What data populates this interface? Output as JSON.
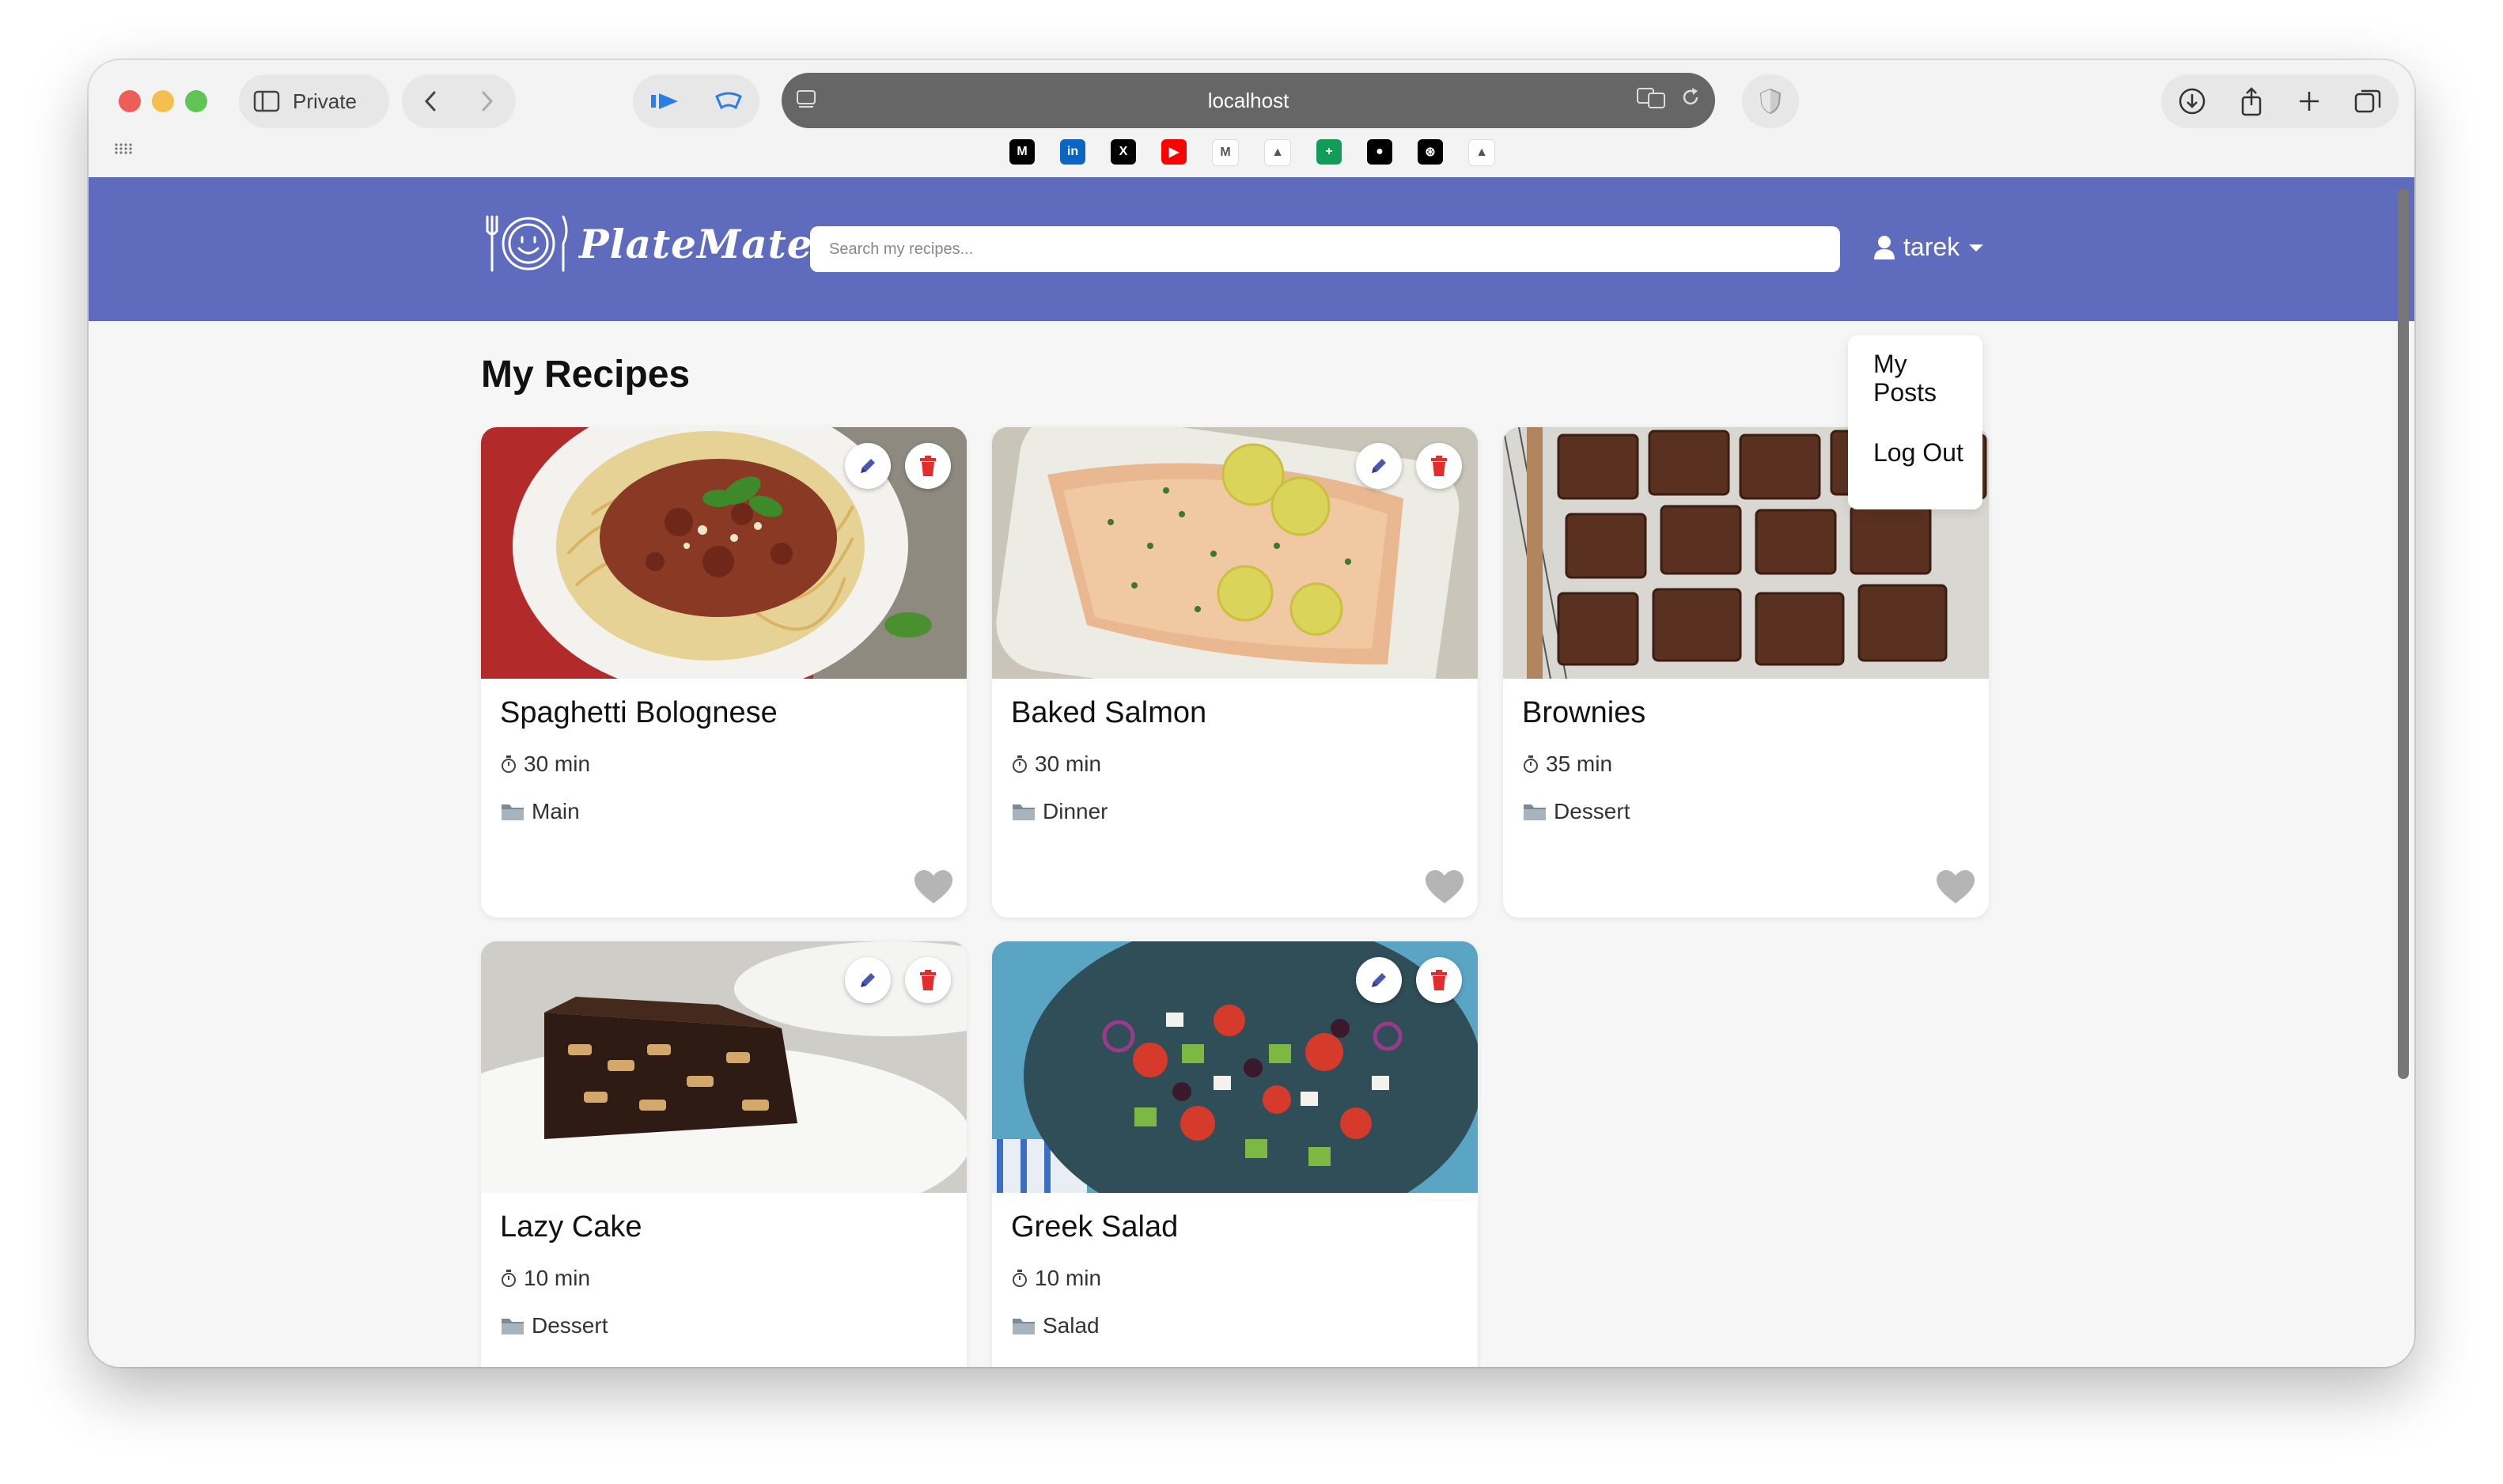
{
  "browser": {
    "private_label": "Private",
    "address": "localhost",
    "bookmarks": [
      {
        "icon": "medium-icon",
        "color": "#000000",
        "glyph": "M"
      },
      {
        "icon": "linkedin-icon",
        "color": "#0a66c2",
        "glyph": "in"
      },
      {
        "icon": "x-icon",
        "color": "#000000",
        "glyph": "X"
      },
      {
        "icon": "youtube-icon",
        "color": "#ff0000",
        "glyph": "▶"
      },
      {
        "icon": "gmail-icon",
        "color": "#ffffff",
        "glyph": "M"
      },
      {
        "icon": "google-drive-icon",
        "color": "#ffffff",
        "glyph": "▲"
      },
      {
        "icon": "google-sheets-icon",
        "color": "#0f9d58",
        "glyph": "+"
      },
      {
        "icon": "github-icon",
        "color": "#000000",
        "glyph": "●"
      },
      {
        "icon": "openai-icon",
        "color": "#000000",
        "glyph": "⊛"
      },
      {
        "icon": "vercel-icon",
        "color": "#ffffff",
        "glyph": "▲"
      }
    ]
  },
  "app": {
    "brand": "PlateMate",
    "brand_color": "#5f6bbd",
    "search_placeholder": "Search my recipes...",
    "username": "tarek",
    "dropdown": {
      "my_posts": "My Posts",
      "log_out": "Log Out"
    }
  },
  "page": {
    "title": "My Recipes"
  },
  "recipes": [
    {
      "title": "Spaghetti Bolognese",
      "time": "30 min",
      "category": "Main",
      "image": "spaghetti-bolognese-photo"
    },
    {
      "title": "Baked Salmon",
      "time": "30 min",
      "category": "Dinner",
      "image": "baked-salmon-photo"
    },
    {
      "title": "Brownies",
      "time": "35 min",
      "category": "Dessert",
      "image": "brownies-photo"
    },
    {
      "title": "Lazy Cake",
      "time": "10 min",
      "category": "Dessert",
      "image": "lazy-cake-photo"
    },
    {
      "title": "Greek Salad",
      "time": "10 min",
      "category": "Salad",
      "image": "greek-salad-photo"
    }
  ]
}
